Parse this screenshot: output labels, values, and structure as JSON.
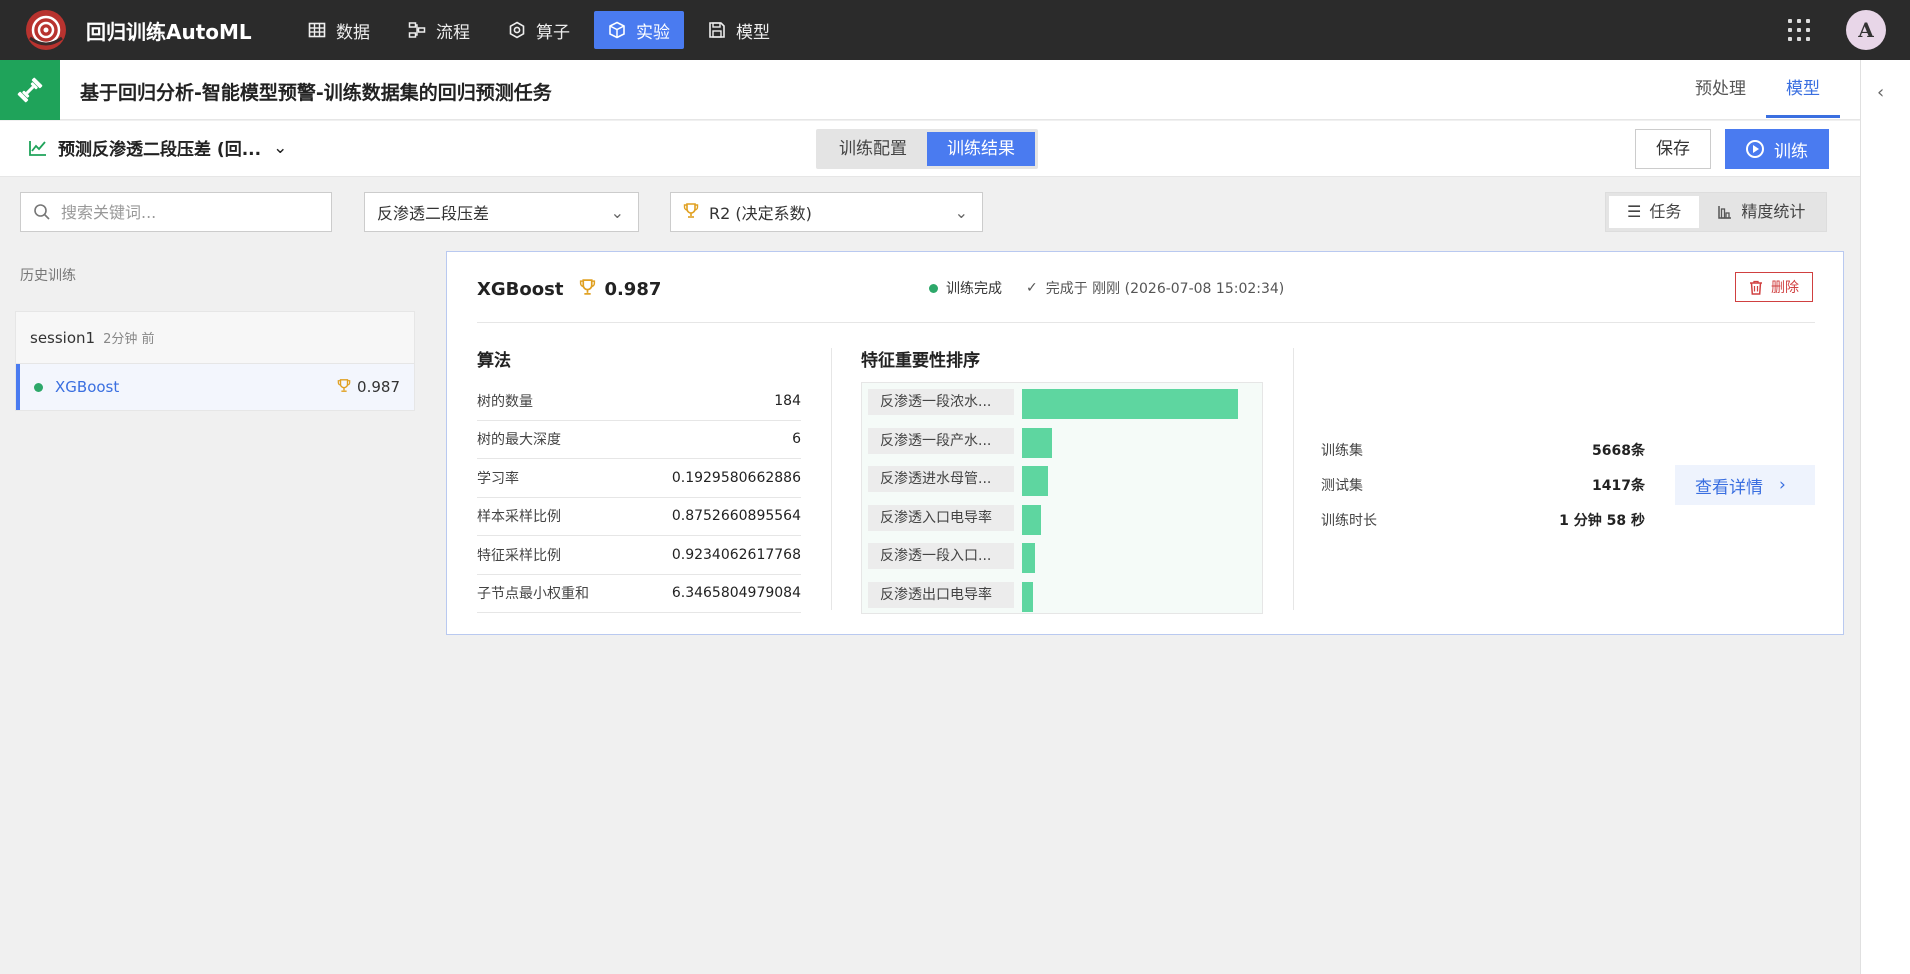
{
  "app": {
    "title": "回归训练AutoML",
    "avatar_initial": "A"
  },
  "nav": [
    {
      "label": "数据",
      "icon": "table-icon"
    },
    {
      "label": "流程",
      "icon": "flow-icon"
    },
    {
      "label": "算子",
      "icon": "operator-icon"
    },
    {
      "label": "实验",
      "icon": "cube-icon",
      "active": true
    },
    {
      "label": "模型",
      "icon": "save-icon"
    }
  ],
  "page": {
    "title": "基于回归分析-智能模型预警-训练数据集的回归预测任务",
    "mode_tabs": [
      "预处理",
      "模型"
    ],
    "active_mode": "模型"
  },
  "toolbar": {
    "task_label": "预测反渗透二段压差 (回...",
    "seg": [
      "训练配置",
      "训练结果"
    ],
    "active_seg": "训练结果",
    "save_label": "保存",
    "train_label": "训练"
  },
  "filters": {
    "search_placeholder": "搜索关键词...",
    "target": "反渗透二段压差",
    "metric": "R2 (决定系数)",
    "view": [
      "任务",
      "精度统计"
    ],
    "active_view": "任务"
  },
  "history": {
    "label": "历史训练",
    "session": {
      "name": "session1",
      "time": "2分钟 前"
    },
    "item": {
      "model": "XGBoost",
      "score": "0.987"
    }
  },
  "result": {
    "model": "XGBoost",
    "score": "0.987",
    "status": "训练完成",
    "done_text": "完成于 刚刚 (2026-07-08 15:02:34)",
    "delete_label": "删除",
    "algo_title": "算法",
    "params": [
      {
        "k": "树的数量",
        "v": "184"
      },
      {
        "k": "树的最大深度",
        "v": "6"
      },
      {
        "k": "学习率",
        "v": "0.1929580662886"
      },
      {
        "k": "样本采样比例",
        "v": "0.8752660895564"
      },
      {
        "k": "特征采样比例",
        "v": "0.9234062617768"
      },
      {
        "k": "子节点最小权重和",
        "v": "6.3465804979084"
      }
    ],
    "feat_title": "特征重要性排序",
    "features": [
      {
        "name": "反渗透一段浓水...",
        "importance": 1.0
      },
      {
        "name": "反渗透一段产水...",
        "importance": 0.14
      },
      {
        "name": "反渗透进水母管...",
        "importance": 0.12
      },
      {
        "name": "反渗透入口电导率",
        "importance": 0.09
      },
      {
        "name": "反渗透一段入口...",
        "importance": 0.06
      },
      {
        "name": "反渗透出口电导率",
        "importance": 0.05
      }
    ],
    "stats": [
      {
        "k": "训练集",
        "v": "5668条"
      },
      {
        "k": "测试集",
        "v": "1417条"
      },
      {
        "k": "训练时长",
        "v": "1 分钟 58 秒"
      }
    ],
    "detail_label": "查看详情"
  },
  "colors": {
    "accent": "#4a7bf0",
    "success": "#2da86a",
    "danger": "#d04040",
    "bar": "#5ed6a0"
  }
}
